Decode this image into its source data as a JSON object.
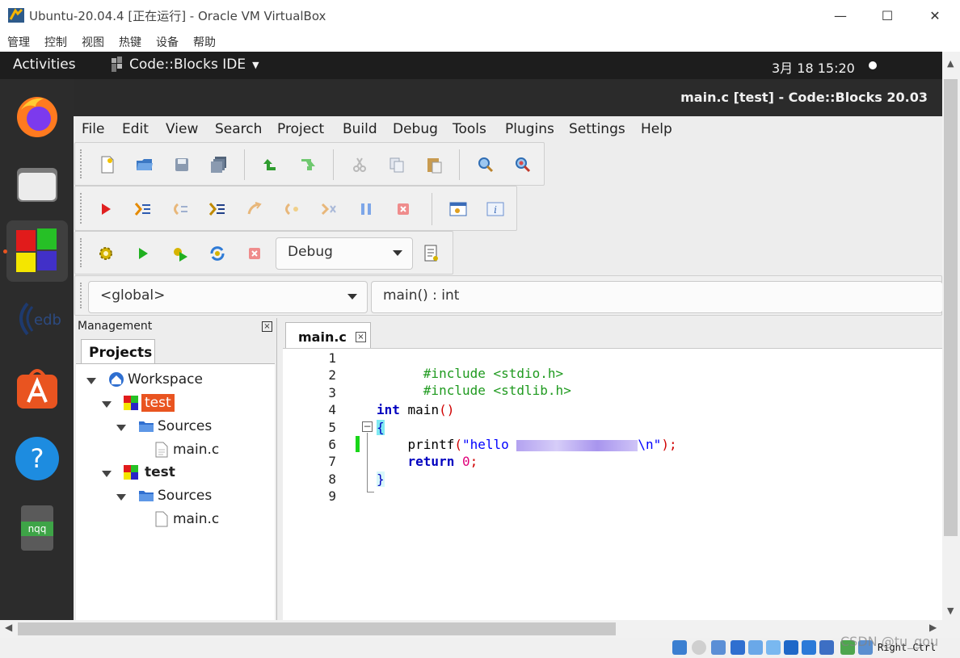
{
  "host_window": {
    "title": "Ubuntu-20.04.4 [正在运行] - Oracle VM VirtualBox",
    "controls": {
      "minimize": "—",
      "maximize": "☐",
      "close": "✕"
    },
    "menu": [
      "管理",
      "控制",
      "视图",
      "热键",
      "设备",
      "帮助"
    ]
  },
  "ubuntu_topbar": {
    "activities": "Activities",
    "app_menu": "Code::Blocks IDE",
    "clock": "3月 18  15:20"
  },
  "dock": {
    "items": [
      "Firefox",
      "Files",
      "Code::Blocks",
      "EDB",
      "Ubuntu Software",
      "Help",
      "nqq"
    ],
    "nqq_label": "nqq"
  },
  "codeblocks": {
    "window_title": "main.c [test] - Code::Blocks 20.03",
    "menu": [
      "File",
      "Edit",
      "View",
      "Search",
      "Project",
      "Build",
      "Debug",
      "Tools",
      "Plugins",
      "Settings",
      "Help"
    ],
    "build_target": "Debug",
    "scope_combo": "<global>",
    "symbol_combo": "main() : int"
  },
  "management": {
    "title": "Management",
    "close": "×",
    "tab": "Projects",
    "tree": {
      "workspace": "Workspace",
      "project1": "test",
      "sources1": "Sources",
      "file1": "main.c",
      "project2": "test",
      "sources2": "Sources",
      "file2": "main.c"
    }
  },
  "editor": {
    "tab_label": "main.c",
    "tab_close": "×",
    "line_numbers": [
      "1",
      "2",
      "3",
      "4",
      "5",
      "6",
      "7",
      "8",
      "9"
    ],
    "code": {
      "l1": "#include <stdio.h>",
      "l2": "#include <stdlib.h>",
      "l4_kw": "int",
      "l4_rest": " main",
      "l4_parens": "()",
      "l5": "{",
      "l6_fn": "    printf",
      "l6_open": "(",
      "l6_str_start": "\"hello ",
      "l6_str_end": "\\n\"",
      "l6_close": ");",
      "l7_kw": "    return",
      "l7_num": "0",
      "l7_semi": ";",
      "l8": "}"
    }
  },
  "status_bar": {
    "host_key": "Right Ctrl",
    "watermark": "CSDN @tu_gou"
  },
  "colors": {
    "ubuntu_orange": "#e95420",
    "dock_bg": "#2c2c2c",
    "topbar_bg": "#1d1d1d",
    "preprocessor": "#1f9a1f",
    "keyword": "#0000c0",
    "string": "#0000ff",
    "number": "#e0007a"
  }
}
